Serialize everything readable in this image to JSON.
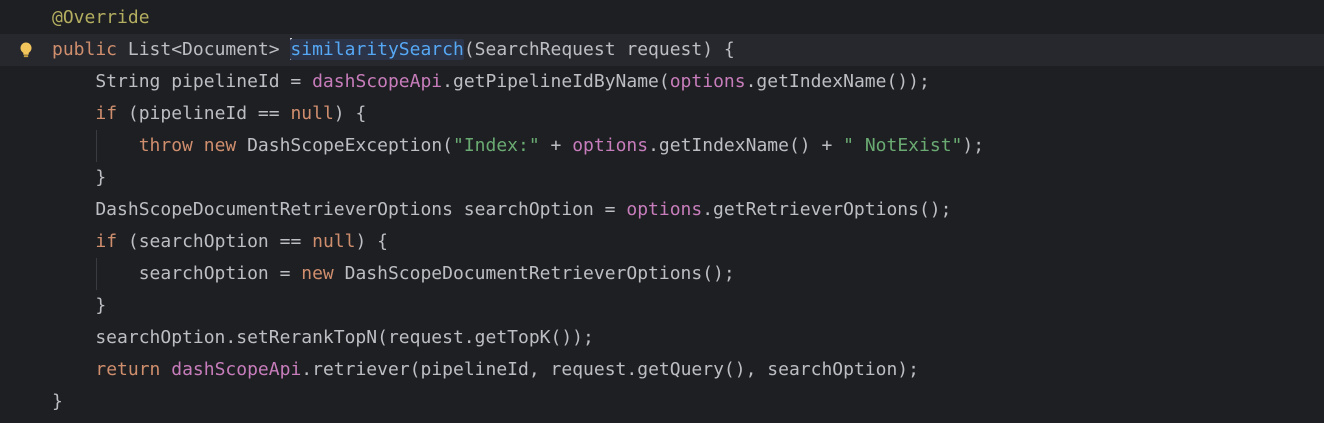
{
  "editor": {
    "gutter_icon": "lightbulb-icon",
    "colors": {
      "background": "#1e1f22",
      "current_line": "#26282e",
      "keyword": "#cf8e6d",
      "annotation": "#b3ae60",
      "method_declaration": "#56a8f5",
      "field": "#c77dbb",
      "string": "#6aab73",
      "plain": "#bcbec4"
    },
    "lines": [
      [
        {
          "t": "@Override",
          "c": "ann"
        }
      ],
      [
        {
          "t": "public",
          "c": "kw"
        },
        {
          "t": " List<Document> ",
          "c": "plain"
        },
        {
          "t": "similaritySearch",
          "c": "fn"
        },
        {
          "t": "(SearchRequest request) {",
          "c": "plain"
        }
      ],
      [
        {
          "t": "    String pipelineId = ",
          "c": "plain"
        },
        {
          "t": "dashScopeApi",
          "c": "field"
        },
        {
          "t": ".getPipelineIdByName(",
          "c": "plain"
        },
        {
          "t": "options",
          "c": "field"
        },
        {
          "t": ".getIndexName());",
          "c": "plain"
        }
      ],
      [
        {
          "t": "    ",
          "c": "plain"
        },
        {
          "t": "if",
          "c": "kw"
        },
        {
          "t": " (pipelineId == ",
          "c": "plain"
        },
        {
          "t": "null",
          "c": "kw"
        },
        {
          "t": ") {",
          "c": "plain"
        }
      ],
      [
        {
          "t": "        ",
          "c": "plain"
        },
        {
          "t": "throw",
          "c": "kw"
        },
        {
          "t": " ",
          "c": "plain"
        },
        {
          "t": "new",
          "c": "kw"
        },
        {
          "t": " DashScopeException(",
          "c": "plain"
        },
        {
          "t": "\"Index:\"",
          "c": "str"
        },
        {
          "t": " + ",
          "c": "plain"
        },
        {
          "t": "options",
          "c": "field"
        },
        {
          "t": ".getIndexName() + ",
          "c": "plain"
        },
        {
          "t": "\" NotExist\"",
          "c": "str"
        },
        {
          "t": ");",
          "c": "plain"
        }
      ],
      [
        {
          "t": "    }",
          "c": "plain"
        }
      ],
      [
        {
          "t": "    DashScopeDocumentRetrieverOptions searchOption = ",
          "c": "plain"
        },
        {
          "t": "options",
          "c": "field"
        },
        {
          "t": ".getRetrieverOptions();",
          "c": "plain"
        }
      ],
      [
        {
          "t": "    ",
          "c": "plain"
        },
        {
          "t": "if",
          "c": "kw"
        },
        {
          "t": " (searchOption == ",
          "c": "plain"
        },
        {
          "t": "null",
          "c": "kw"
        },
        {
          "t": ") {",
          "c": "plain"
        }
      ],
      [
        {
          "t": "        searchOption = ",
          "c": "plain"
        },
        {
          "t": "new",
          "c": "kw"
        },
        {
          "t": " DashScopeDocumentRetrieverOptions();",
          "c": "plain"
        }
      ],
      [
        {
          "t": "    }",
          "c": "plain"
        }
      ],
      [
        {
          "t": "    searchOption.setRerankTopN(request.getTopK());",
          "c": "plain"
        }
      ],
      [
        {
          "t": "    ",
          "c": "plain"
        },
        {
          "t": "return",
          "c": "kw"
        },
        {
          "t": " ",
          "c": "plain"
        },
        {
          "t": "dashScopeApi",
          "c": "field"
        },
        {
          "t": ".retriever(pipelineId, request.getQuery(), searchOption);",
          "c": "plain"
        }
      ],
      [
        {
          "t": "}",
          "c": "plain"
        }
      ]
    ]
  }
}
